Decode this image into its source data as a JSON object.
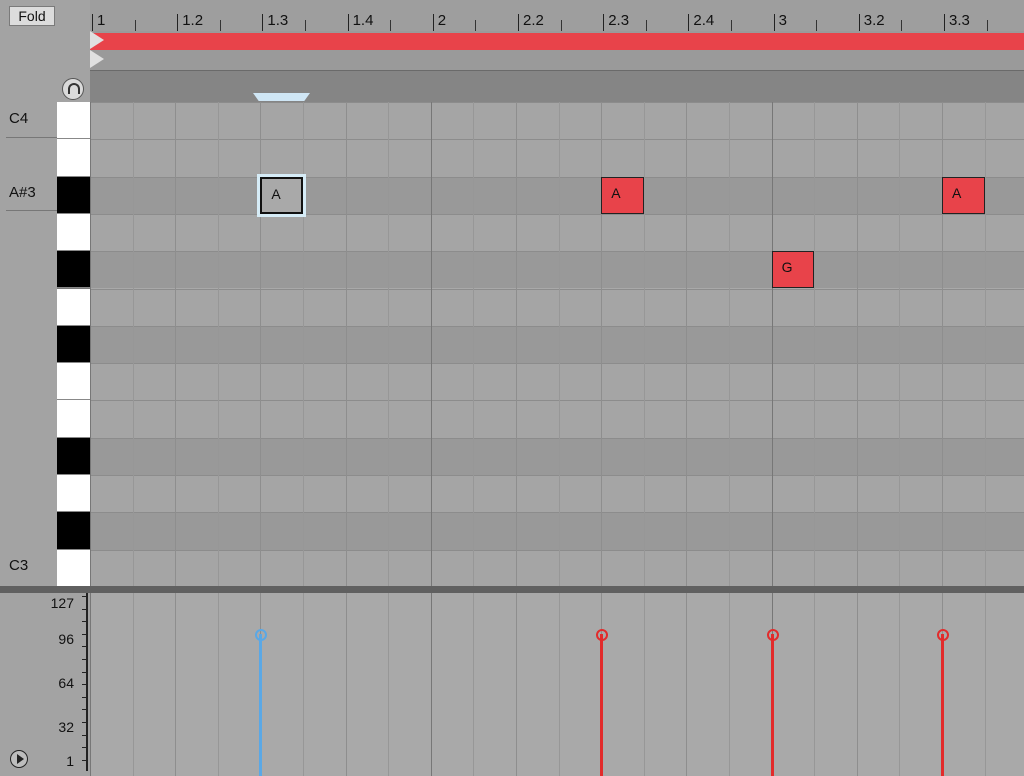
{
  "fold_label": "Fold",
  "ruler": {
    "labels": [
      "1",
      "1.2",
      "1.3",
      "1.4",
      "2",
      "2.2",
      "2.3",
      "2.4",
      "3",
      "3.2",
      "3.3"
    ]
  },
  "note_names": [
    "C4",
    "A#3",
    "C3"
  ],
  "notes": [
    {
      "label": "A",
      "selected": true
    },
    {
      "label": "A",
      "selected": false
    },
    {
      "label": "A",
      "selected": false
    },
    {
      "label": "G",
      "selected": false
    }
  ],
  "velocity": {
    "scale_labels": [
      "127",
      "96",
      "64",
      "32",
      "1"
    ],
    "values": [
      100,
      100,
      100,
      100
    ]
  },
  "colors": {
    "note": "#e8434a",
    "loop_brace": "#e8434a",
    "velocity": "#e22b2b",
    "velocity_selected": "#5aa8e6",
    "selection_outline": "#d6ecf7"
  }
}
